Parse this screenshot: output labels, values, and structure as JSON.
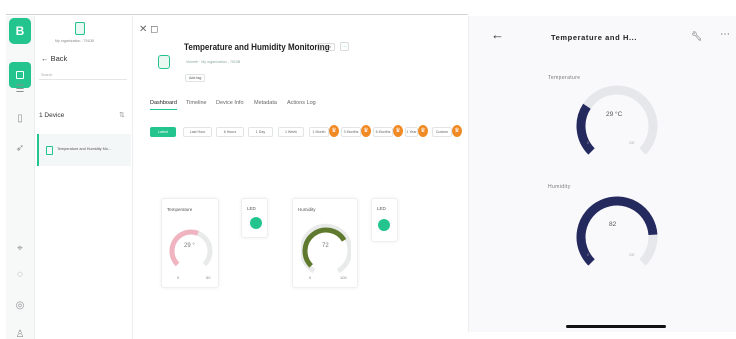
{
  "colors": {
    "accent": "#23c48e",
    "gauge_navy": "#24295e",
    "gauge_olive": "#5f7a2e",
    "gauge_pink": "#f0b3c0",
    "premium": "#f08a24"
  },
  "rail": {
    "logo": "B",
    "icons": [
      "home-icon",
      "list-icon",
      "devices-icon",
      "rocket-icon",
      "location-icon",
      "bulb-icon",
      "help-icon",
      "user-icon"
    ]
  },
  "device_panel": {
    "org_label": "My organization - 7910B",
    "back_label": "← Back",
    "search_placeholder": "Search",
    "device_count": "1 Device",
    "devices": [
      {
        "name": "Temperature and Humidity Mo..."
      }
    ]
  },
  "main": {
    "title": "Temperature and Humidity Monitoring",
    "status": "Offline",
    "more": "⋯",
    "owner_line": "Vineeth  ·  My organization - 7910B",
    "add_tag": "Add tag",
    "tabs": [
      "Dashboard",
      "Timeline",
      "Device Info",
      "Metadata",
      "Actions Log"
    ],
    "ranges": [
      "Latest",
      "Last Hour",
      "6 Hours",
      "1 Day",
      "1 Week",
      "1 Month",
      "3 Months",
      "6 Months",
      "1 Year",
      "Custom"
    ],
    "widgets": {
      "temperature": {
        "label": "Temperature",
        "value": "29 °",
        "min": "0",
        "max": "50",
        "level": 0.58
      },
      "led1": {
        "label": "LED"
      },
      "humidity": {
        "label": "Humidity",
        "value": "72",
        "min": "0",
        "max": "100",
        "level": 0.72
      },
      "led2": {
        "label": "LED"
      }
    }
  },
  "phone": {
    "back": "←",
    "title": "Temperature and H...",
    "gauges": [
      {
        "label": "Temperature",
        "value": "29 °C",
        "min": "0",
        "max": "100",
        "level": 0.29
      },
      {
        "label": "Humidity",
        "value": "82",
        "min": "0",
        "max": "100",
        "level": 0.82
      }
    ]
  }
}
